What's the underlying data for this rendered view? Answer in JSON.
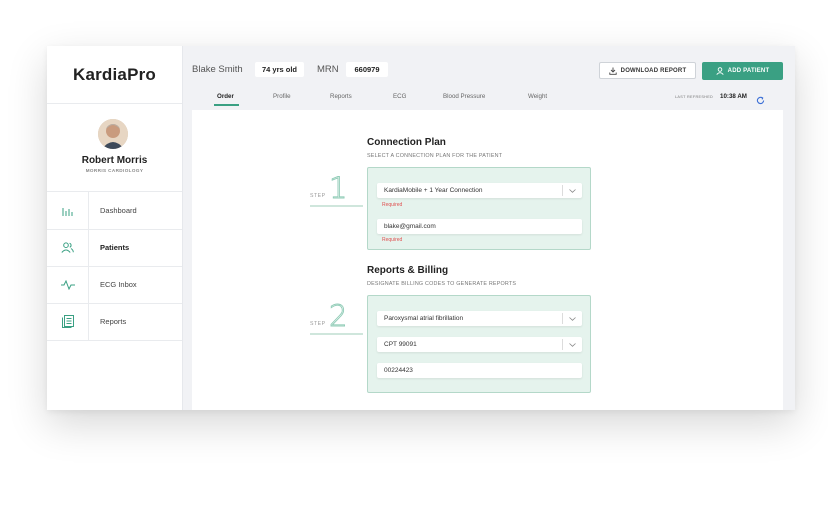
{
  "app": {
    "logo": "KardiaPro"
  },
  "doctor": {
    "name": "Robert Morris",
    "org": "MORRIS CARDIOLOGY"
  },
  "sidebar": {
    "items": [
      {
        "label": "Dashboard",
        "icon": "bar-chart-icon"
      },
      {
        "label": "Patients",
        "icon": "users-icon",
        "active": true
      },
      {
        "label": "ECG Inbox",
        "icon": "heartbeat-icon"
      },
      {
        "label": "Reports",
        "icon": "document-icon"
      }
    ]
  },
  "patient": {
    "name": "Blake Smith",
    "age": "74 yrs old",
    "mrn_label": "MRN",
    "mrn": "660979"
  },
  "actions": {
    "download": "DOWNLOAD REPORT",
    "add_patient": "ADD PATIENT"
  },
  "tabs": [
    "Order",
    "Profile",
    "Reports",
    "ECG",
    "Blood Pressure",
    "Weight"
  ],
  "active_tab": "Order",
  "refresh": {
    "label": "LAST REFRESHED",
    "time": "10:38 AM"
  },
  "connection": {
    "title": "Connection Plan",
    "subtitle": "SELECT A CONNECTION PLAN FOR THE PATIENT",
    "step_label": "STEP",
    "step_num": "1",
    "plan_value": "KardiaMobile + 1 Year Connection",
    "plan_required": "Required",
    "email_value": "blake@gmail.com",
    "email_required": "Required"
  },
  "billing": {
    "title": "Reports & Billing",
    "subtitle": "DESIGNATE BILLING CODES TO GENERATE REPORTS",
    "step_label": "STEP",
    "step_num": "2",
    "diagnosis_value": "Paroxysmal atrial fibrillation",
    "cpt_value": "CPT 99091",
    "code_value": "00224423"
  },
  "colors": {
    "accent": "#3aa083",
    "panel_bg": "#e5f3ed",
    "panel_border": "#b4d8c9",
    "required": "#e05050"
  }
}
